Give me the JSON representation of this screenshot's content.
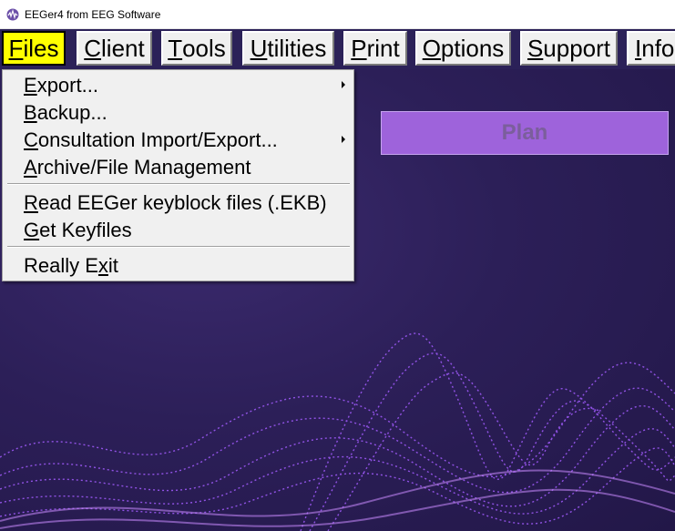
{
  "window": {
    "title": "EEGer4 from EEG Software",
    "icon": "eeger-app-icon"
  },
  "menubar": {
    "items": [
      {
        "label": "Files",
        "key": "F",
        "rest": "iles",
        "active": true
      },
      {
        "label": "Client",
        "key": "C",
        "rest": "lient"
      },
      {
        "label": "Tools",
        "key": "T",
        "rest": "ools"
      },
      {
        "label": "Utilities",
        "key": "U",
        "rest": "tilities"
      },
      {
        "label": "Print",
        "key": "P",
        "rest": "rint"
      },
      {
        "label": "Options",
        "key": "O",
        "rest": "ptions"
      },
      {
        "label": "Support",
        "key": "S",
        "rest": "upport"
      },
      {
        "label": "Info",
        "key": "I",
        "rest": "nfo"
      }
    ]
  },
  "files_menu": {
    "items": [
      {
        "pre": "",
        "key": "E",
        "post": "xport...",
        "submenu": true
      },
      {
        "pre": "",
        "key": "B",
        "post": "ackup...",
        "submenu": false
      },
      {
        "pre": "",
        "key": "C",
        "post": "onsultation Import/Export...",
        "submenu": true
      },
      {
        "pre": "",
        "key": "A",
        "post": "rchive/File Management",
        "submenu": false
      },
      {
        "pre": "",
        "key": "R",
        "post": "ead EEGer keyblock files (.EKB)",
        "submenu": false
      },
      {
        "pre": "",
        "key": "G",
        "post": "et Keyfiles",
        "submenu": false
      },
      {
        "pre": "Really E",
        "key": "x",
        "post": "it",
        "submenu": false
      }
    ]
  },
  "main": {
    "plan_label": "Plan"
  },
  "colors": {
    "background": "#2c1f58",
    "menu_active": "#ffff00",
    "plan_button": "#9e63db",
    "plan_text": "#7b5e9c",
    "waves": "#9b4dff"
  }
}
